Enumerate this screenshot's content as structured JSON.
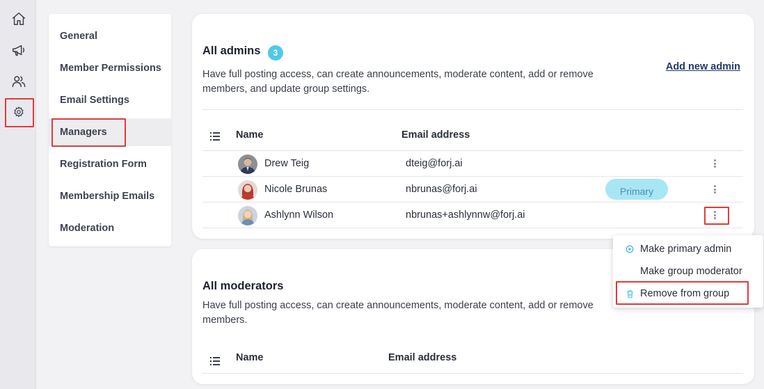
{
  "rail": {
    "icons": [
      "home-icon",
      "megaphone-icon",
      "people-icon",
      "gear-icon"
    ]
  },
  "nav": {
    "items": [
      {
        "label": "General"
      },
      {
        "label": "Member Permissions"
      },
      {
        "label": "Email Settings"
      },
      {
        "label": "Managers",
        "active": true
      },
      {
        "label": "Registration Form"
      },
      {
        "label": "Membership Emails"
      },
      {
        "label": "Moderation"
      }
    ]
  },
  "admins": {
    "title": "All admins",
    "count": "3",
    "description": "Have full posting access, can create announcements, moderate content, add or remove members, and update group settings.",
    "add_label": "Add new admin",
    "columns": {
      "name": "Name",
      "email": "Email address"
    },
    "rows": [
      {
        "name": "Drew Teig",
        "email": "dteig@forj.ai"
      },
      {
        "name": "Nicole Brunas",
        "email": "nbrunas@forj.ai",
        "badge": "Primary"
      },
      {
        "name": "Ashlynn Wilson",
        "email": "nbrunas+ashlynnw@forj.ai"
      }
    ]
  },
  "moderators": {
    "title": "All moderators",
    "description": "Have full posting access, can create announcements, moderate content, add or remove members.",
    "columns": {
      "name": "Name",
      "email": "Email address"
    }
  },
  "row_menu": {
    "items": [
      {
        "label": "Make primary admin",
        "icon": "plus-circle-icon"
      },
      {
        "label": "Make group moderator"
      },
      {
        "label": "Remove from group",
        "icon": "trash-icon"
      }
    ]
  },
  "colors": {
    "accent": "#4fc9ea",
    "highlight": "#e23b3b",
    "link": "#233a6a"
  }
}
